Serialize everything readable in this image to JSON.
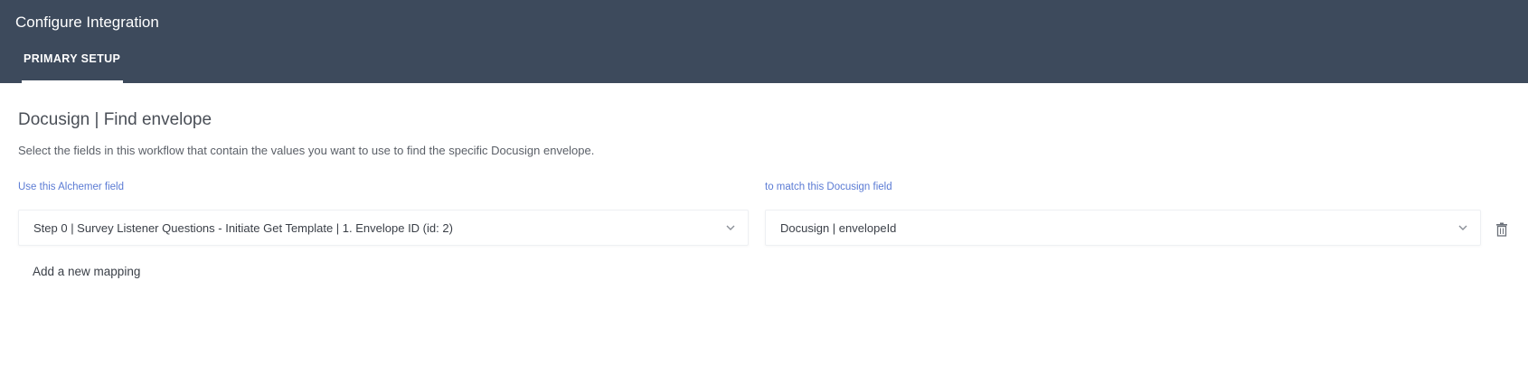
{
  "header": {
    "title": "Configure Integration",
    "tabs": [
      {
        "label": "PRIMARY SETUP",
        "active": true
      }
    ]
  },
  "main": {
    "heading": "Docusign | Find envelope",
    "description": "Select the fields in this workflow that contain the values you want to use to find the specific Docusign envelope.",
    "left_label": "Use this Alchemer field",
    "right_label": "to match this Docusign field",
    "mappings": [
      {
        "alchemer_field": "Step 0 | Survey Listener Questions - Initiate Get Template | 1. Envelope ID (id: 2)",
        "docusign_field": "Docusign | envelopeId"
      }
    ],
    "add_mapping_label": "Add a new mapping"
  },
  "icons": {
    "dropdown": "chevron-down-icon",
    "delete": "trash-icon"
  },
  "colors": {
    "header_bg": "#3d4a5c",
    "label_blue": "#5b7bd4"
  }
}
